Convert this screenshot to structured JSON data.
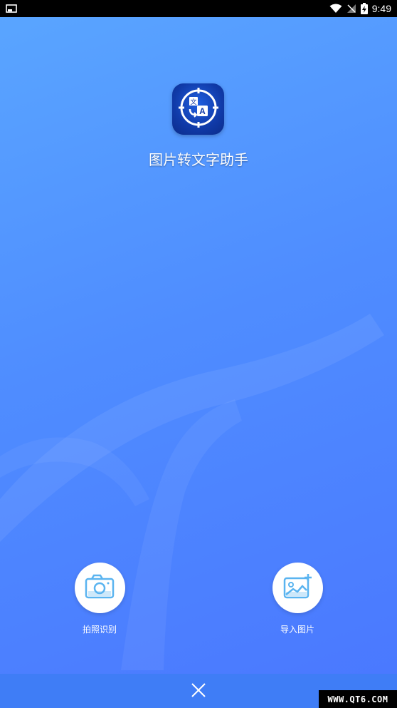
{
  "status_bar": {
    "time": "9:49",
    "left_icon": "screen-icon",
    "icons": [
      "wifi-icon",
      "no-sim-icon",
      "battery-icon"
    ]
  },
  "app": {
    "name": "图片转文字助手",
    "logo_icon": "translate-scan-icon"
  },
  "actions": [
    {
      "label": "拍照识别",
      "icon": "camera-icon"
    },
    {
      "label": "导入图片",
      "icon": "import-image-icon"
    }
  ],
  "bottom_bar": {
    "icon": "close-icon"
  },
  "watermark": "WWW.QT6.COM",
  "colors": {
    "background_start": "#5aa6ff",
    "background_end": "#4a77ff",
    "bottom_bar": "#3f7df6",
    "icon_accent": "#5ab4f0"
  }
}
